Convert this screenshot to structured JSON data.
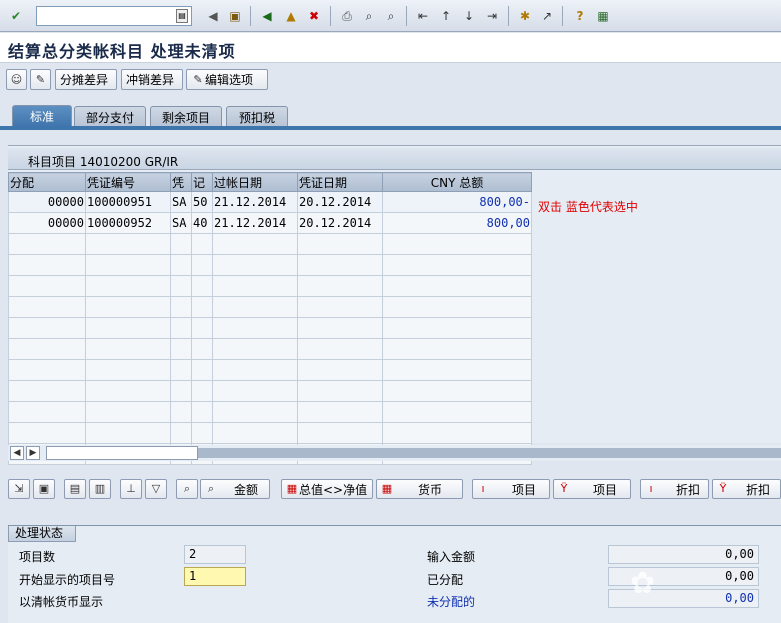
{
  "toolbar": {
    "icons": [
      "check-icon",
      "command-field",
      "back-icon",
      "save-icon",
      "back-nav-icon",
      "exit-icon",
      "cancel-icon",
      "print-icon",
      "find-icon",
      "find-next-icon",
      "first-page-icon",
      "prev-page-icon",
      "next-page-icon",
      "last-page-icon",
      "new-session-icon",
      "shortcut-icon",
      "help-icon",
      "layout-icon"
    ],
    "command_value": ""
  },
  "title": "结算总分类帐科目 处理未清项",
  "app_toolbar": {
    "btn1": "分摊差异",
    "btn2": "冲销差异",
    "btn3": "编辑选项"
  },
  "tabs": [
    "标准",
    "部分支付",
    "剩余项目",
    "预扣税"
  ],
  "table": {
    "title": "科目项目 14010200 GR/IR",
    "columns": [
      "分配",
      "凭证编号",
      "凭",
      "记",
      "过帐日期",
      "凭证日期",
      "CNY 总额"
    ],
    "rows": [
      [
        "00000",
        "100000951",
        "SA",
        "50",
        "21.12.2014",
        "20.12.2014",
        "800,00-"
      ],
      [
        "00000",
        "100000952",
        "SA",
        "40",
        "21.12.2014",
        "20.12.2014",
        "800,00"
      ]
    ],
    "empty_rows": 11,
    "annotation": "双击 蓝色代表选中"
  },
  "bottom_toolbar": {
    "amount": "金额",
    "gross_net": "总值<>净值",
    "currency": "货币",
    "item1": "项目",
    "item2": "项目",
    "discount1": "折扣",
    "discount2": "折扣"
  },
  "status": {
    "group_title": "处理状态",
    "item_count_label": "项目数",
    "item_count": "2",
    "first_item_label": "开始显示的项目号",
    "first_item": "1",
    "currency_display_label": "以清帐货币显示",
    "entered_amount_label": "输入金额",
    "entered_amount": "0,00",
    "assigned_label": "已分配",
    "assigned": "0,00",
    "unassigned_label": "未分配的",
    "unassigned": "0,00"
  }
}
